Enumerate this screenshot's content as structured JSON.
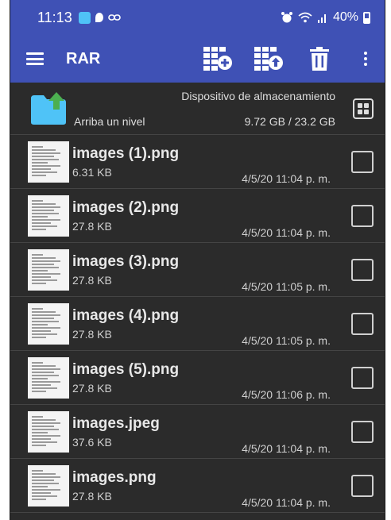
{
  "status_bar": {
    "time": "11:13",
    "battery_text": "40%"
  },
  "toolbar": {
    "title": "RAR",
    "actions": [
      "archive-add-icon",
      "archive-extract-icon",
      "trash-icon",
      "more-vert-icon"
    ]
  },
  "parent_row": {
    "label": "Arriba un nivel",
    "storage_name": "Dispositivo de almacenamiento",
    "storage_usage": "9.72 GB / 23.2 GB"
  },
  "files": [
    {
      "name": "images (1).png",
      "size": "6.31 KB",
      "date": "4/5/20 11:04 p. m."
    },
    {
      "name": "images (2).png",
      "size": "27.8 KB",
      "date": "4/5/20 11:04 p. m."
    },
    {
      "name": "images (3).png",
      "size": "27.8 KB",
      "date": "4/5/20 11:05 p. m."
    },
    {
      "name": "images (4).png",
      "size": "27.8 KB",
      "date": "4/5/20 11:05 p. m."
    },
    {
      "name": "images (5).png",
      "size": "27.8 KB",
      "date": "4/5/20 11:06 p. m."
    },
    {
      "name": "images.jpeg",
      "size": "37.6 KB",
      "date": "4/5/20 11:04 p. m."
    },
    {
      "name": "images.png",
      "size": "27.8 KB",
      "date": "4/5/20 11:04 p. m."
    }
  ],
  "colors": {
    "primary": "#3f51b5",
    "background": "#2b2b2b",
    "folder": "#4fc3f7",
    "folder_arrow": "#4caf50"
  }
}
